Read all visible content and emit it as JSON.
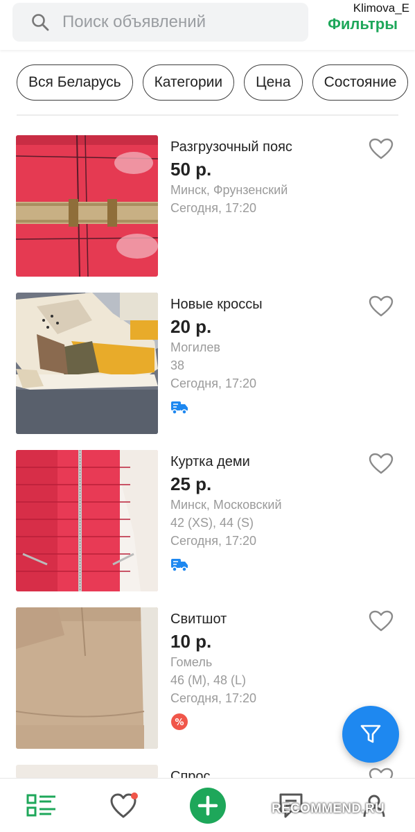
{
  "search": {
    "placeholder": "Поиск объявлений",
    "filters_label": "Фильтры"
  },
  "watermark": {
    "user": "Klimova_E",
    "site": "RECOMMEND.RU"
  },
  "chips": [
    "Вся Беларусь",
    "Категории",
    "Цена",
    "Состояние"
  ],
  "listings": [
    {
      "title": "Разгрузочный пояс",
      "price": "50 р.",
      "location": "Минск, Фрунзенский",
      "size": "",
      "date": "Сегодня, 17:20",
      "badge": ""
    },
    {
      "title": "Новые кроссы",
      "price": "20 р.",
      "location": "Могилев",
      "size": "38",
      "date": "Сегодня, 17:20",
      "badge": "delivery-truck-icon"
    },
    {
      "title": "Куртка деми",
      "price": "25 р.",
      "location": "Минск, Московский",
      "size": "42 (XS), 44 (S)",
      "date": "Сегодня, 17:20",
      "badge": "delivery-truck-icon"
    },
    {
      "title": "Свитшот",
      "price": "10 р.",
      "location": "Гомель",
      "size": "46 (M), 48 (L)",
      "date": "Сегодня, 17:20",
      "badge": "discount-percent-icon"
    },
    {
      "title": "Спрос",
      "price": "",
      "location": "",
      "size": "",
      "date": "",
      "badge": ""
    }
  ],
  "bottom_nav": [
    "listings-icon",
    "favorites-icon",
    "add-listing-icon",
    "messages-icon",
    "profile-icon"
  ],
  "colors": {
    "accent_green": "#1ea75a",
    "fab_blue": "#1e88f0",
    "delivery_blue": "#1e88f0",
    "discount_red": "#f0564a"
  }
}
